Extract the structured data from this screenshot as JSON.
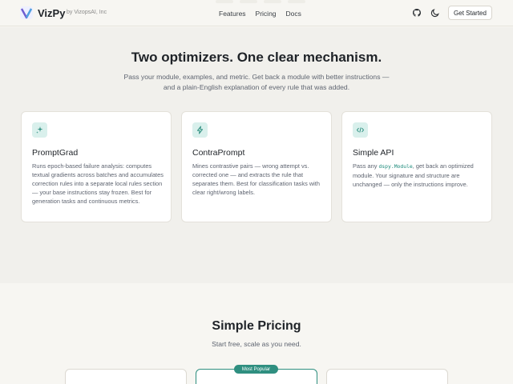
{
  "header": {
    "brand": "VizPy",
    "byline": "by VizopsAI, Inc",
    "nav": [
      "Features",
      "Pricing",
      "Docs"
    ],
    "cta_label": "Get Started",
    "icons": [
      "logo-icon",
      "github-icon",
      "moon-icon"
    ]
  },
  "features": {
    "title": "Two optimizers. One clear mechanism.",
    "subtitle_line1": "Pass your module, examples, and metric. Get back a module with better instructions —",
    "subtitle_line2": "and a plain-English explanation of every rule that was added.",
    "cards": [
      {
        "icon": "sparkles-icon",
        "title": "PromptGrad",
        "body": "Runs epoch-based failure analysis: computes textual gradients across batches and accumulates correction rules into a separate local rules section — your base instructions stay frozen. Best for generation tasks and continuous metrics."
      },
      {
        "icon": "bolt-icon",
        "title": "ContraPrompt",
        "body": "Mines contrastive pairs — wrong attempt vs. corrected one — and extracts the rule that separates them. Best for classification tasks with clear right/wrong labels."
      },
      {
        "icon": "code-icon",
        "title": "Simple API",
        "body_pre": "Pass any ",
        "body_code": "dspy.Module",
        "body_post": ", get back an optimized module. Your signature and structure are unchanged — only the instructions improve."
      }
    ]
  },
  "pricing": {
    "title": "Simple Pricing",
    "subtitle": "Start free, scale as you need.",
    "popular_badge": "Most Popular"
  },
  "colors": {
    "accent": "#2f8f80",
    "page_bg": "#f7f6f2",
    "section_bg": "#f1f0ec",
    "icon_badge_bg": "#d9f0ec"
  }
}
